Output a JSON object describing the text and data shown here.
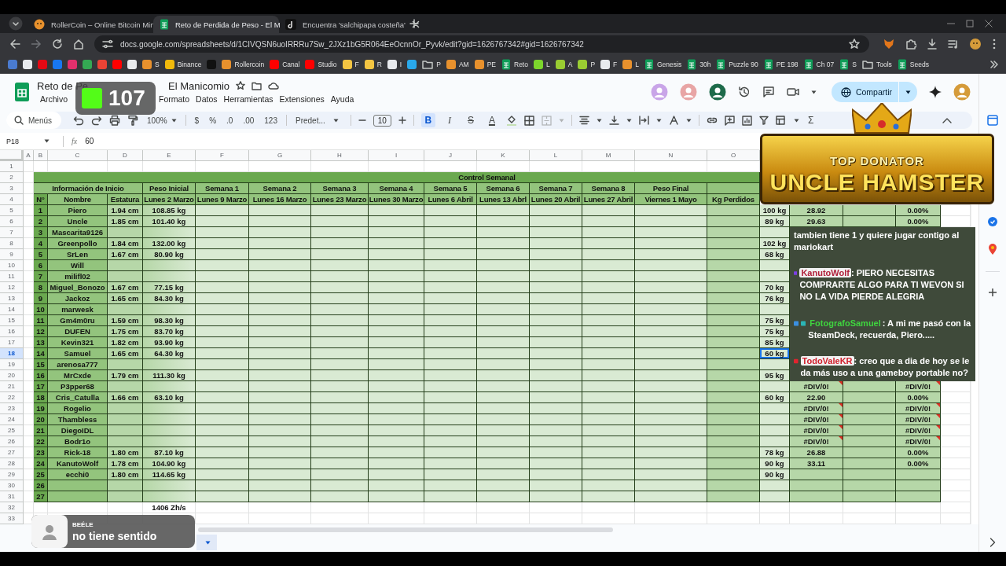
{
  "browser": {
    "tabs": [
      {
        "title": "RollerCoin – Online Bitcoin Min",
        "kind": "site",
        "selected": false
      },
      {
        "title": "Reto de Perdida de Peso - El M",
        "kind": "sheet",
        "selected": true
      },
      {
        "title": "Encuentra 'salchipapa costeña'",
        "kind": "music",
        "selected": false
      }
    ],
    "url": "docs.google.com/spreadsheets/d/1CIVQSN6uoIRRRu7Sw_2JXz1bG5R064EeOcnnOr_Pyvk/edit?gid=1626767342#gid=1626767342",
    "bookmarks": [
      {
        "kind": "site",
        "color": "#4a7bd0"
      },
      {
        "kind": "site",
        "color": "#e8eaed"
      },
      {
        "kind": "site",
        "color": "#e50914"
      },
      {
        "kind": "site",
        "color": "#1877f2"
      },
      {
        "kind": "site",
        "color": "#e1306c"
      },
      {
        "kind": "site",
        "color": "#34a853"
      },
      {
        "kind": "site",
        "color": "#ea4335"
      },
      {
        "kind": "site",
        "color": "#ff0000"
      },
      {
        "kind": "site",
        "color": "#e8eaed"
      },
      {
        "kind": "site",
        "color": "#e8912d",
        "label": "S"
      },
      {
        "kind": "site",
        "color": "#f0b90b",
        "label": "Binance"
      },
      {
        "kind": "site",
        "color": "#111111"
      },
      {
        "kind": "site",
        "color": "#e8912d",
        "label": "Rollercoin"
      },
      {
        "kind": "site",
        "color": "#ff0000",
        "label": "Canal"
      },
      {
        "kind": "site",
        "color": "#ff0000",
        "label": "Studio"
      },
      {
        "kind": "site",
        "color": "#f4c542",
        "label": "F"
      },
      {
        "kind": "site",
        "color": "#f4c542",
        "label": "R"
      },
      {
        "kind": "site",
        "color": "#e8eaed",
        "label": "I"
      },
      {
        "kind": "site",
        "color": "#29a9eb"
      },
      {
        "kind": "folder",
        "label": "P"
      },
      {
        "kind": "site",
        "color": "#e8912d",
        "label": "AM"
      },
      {
        "kind": "site",
        "color": "#e8912d",
        "label": "PE"
      },
      {
        "kind": "sheet",
        "label": "Reto"
      },
      {
        "kind": "site",
        "color": "#7cd52c",
        "label": "L"
      },
      {
        "kind": "site",
        "color": "#9acd32",
        "label": "A"
      },
      {
        "kind": "site",
        "color": "#9acd32",
        "label": "P"
      },
      {
        "kind": "site",
        "color": "#e8eaed",
        "label": "F"
      },
      {
        "kind": "site",
        "color": "#e8912d",
        "label": "L"
      },
      {
        "kind": "sheet",
        "label": "Genesis"
      },
      {
        "kind": "sheet",
        "label": "30h"
      },
      {
        "kind": "sheet",
        "label": "Puzzle 90"
      },
      {
        "kind": "sheet",
        "label": "PE 198"
      },
      {
        "kind": "sheet",
        "label": "Ch 07"
      },
      {
        "kind": "sheet",
        "label": "S"
      },
      {
        "kind": "folder",
        "label": "Tools"
      },
      {
        "kind": "sheet",
        "label": "Seeds"
      }
    ]
  },
  "document": {
    "title_parts": [
      "Reto de Pe",
      "El Manicomio"
    ],
    "menu": [
      "Archivo",
      "Formato",
      "Datos",
      "Herramientas",
      "Extensiones",
      "Ayuda"
    ],
    "share": "Compartir"
  },
  "toolbar": {
    "search": "Menús",
    "zoom": "100%",
    "number_formats": [
      "$",
      "%",
      ".0",
      ".00",
      "123"
    ],
    "font": "Predet...",
    "size": "10",
    "text_styles": [
      {
        "label": "B",
        "selected": true
      },
      {
        "label": "I",
        "selected": false
      },
      {
        "label": "S",
        "selected": false
      },
      {
        "label": "A",
        "selected": false
      }
    ],
    "functions": "Σ"
  },
  "formula_bar": {
    "cell": "P18",
    "fx": "fx",
    "formula": "60"
  },
  "columns": [
    "A",
    "B",
    "C",
    "D",
    "E",
    "F",
    "G",
    "H",
    "I",
    "J",
    "K",
    "L",
    "M",
    "N",
    "O"
  ],
  "row_headers": [
    {
      "label": "1",
      "selected": false
    },
    {
      "label": "2",
      "selected": false
    },
    {
      "label": "3",
      "selected": false
    },
    {
      "label": "4",
      "selected": false
    },
    {
      "label": "5",
      "selected": false
    },
    {
      "label": "6",
      "selected": false
    },
    {
      "label": "7",
      "selected": false
    },
    {
      "label": "8",
      "selected": false
    },
    {
      "label": "9",
      "selected": false
    },
    {
      "label": "10",
      "selected": false
    },
    {
      "label": "11",
      "selected": false
    },
    {
      "label": "12",
      "selected": false
    },
    {
      "label": "13",
      "selected": false
    },
    {
      "label": "14",
      "selected": false
    },
    {
      "label": "15",
      "selected": false
    },
    {
      "label": "16",
      "selected": false
    },
    {
      "label": "17",
      "selected": false
    },
    {
      "label": "18",
      "selected": true
    },
    {
      "label": "19",
      "selected": false
    },
    {
      "label": "20",
      "selected": false
    },
    {
      "label": "21",
      "selected": false
    },
    {
      "label": "22",
      "selected": false
    },
    {
      "label": "23",
      "selected": false
    },
    {
      "label": "24",
      "selected": false
    },
    {
      "label": "25",
      "selected": false
    },
    {
      "label": "26",
      "selected": false
    },
    {
      "label": "27",
      "selected": false
    },
    {
      "label": "28",
      "selected": false
    },
    {
      "label": "29",
      "selected": false
    },
    {
      "label": "30",
      "selected": false
    },
    {
      "label": "31",
      "selected": false
    },
    {
      "label": "32",
      "selected": false
    },
    {
      "label": "33",
      "selected": false
    }
  ],
  "sheet": {
    "section_title": "Control Semanal",
    "group_header": "Información de Inicio",
    "period_headers": [
      "Peso Inicial",
      "Semana 1",
      "Semana 2",
      "Semana 3",
      "Semana 4",
      "Semana 5",
      "Semana 6",
      "Semana 7",
      "Semana 8",
      "Peso Final"
    ],
    "column_headers": [
      "N°",
      "Nombre",
      "Estatura",
      "Lunes 2 Marzo",
      "Lunes 9 Marzo",
      "Lunes 16 Marzo",
      "Lunes 23 Marzo",
      "Lunes 30 Marzo",
      "Lunes 6 Abril",
      "Lunes 13 Abrl",
      "Lunes 20 Abril",
      "Lunes 27 Abril",
      "Viernes 1 Mayo",
      "Kg Perdidos"
    ],
    "participants": [
      {
        "n": "1",
        "name": "Piero",
        "height": "1.94 cm",
        "weight": "108.85 kg",
        "goal": "100 kg",
        "column_q": "28.92",
        "column_s": "0.00%",
        "error": false,
        "selected": false
      },
      {
        "n": "2",
        "name": "Uncle",
        "height": "1.85 cm",
        "weight": "101.40 kg",
        "goal": "89 kg",
        "column_q": "29.63",
        "column_s": "0.00%",
        "error": false,
        "selected": false
      },
      {
        "n": "3",
        "name": "Mascarita9126",
        "selected": false
      },
      {
        "n": "4",
        "name": "Greenpollo",
        "height": "1.84 cm",
        "weight": "132.00 kg",
        "goal": "102 kg",
        "selected": false
      },
      {
        "n": "5",
        "name": "SrLen",
        "height": "1.67 cm",
        "weight": "80.90 kg",
        "goal": "68 kg",
        "selected": false
      },
      {
        "n": "6",
        "name": "Will",
        "selected": false
      },
      {
        "n": "7",
        "name": "milifl02",
        "selected": false
      },
      {
        "n": "8",
        "name": "Miguel_Bonozo",
        "height": "1.67 cm",
        "weight": "77.15 kg",
        "goal": "70 kg",
        "selected": false
      },
      {
        "n": "9",
        "name": "Jackoz",
        "height": "1.65 cm",
        "weight": "84.30 kg",
        "goal": "76 kg",
        "selected": false
      },
      {
        "n": "10",
        "name": "marwesk",
        "selected": false
      },
      {
        "n": "11",
        "name": "Gm4m0ru",
        "height": "1.59 cm",
        "weight": "98.30 kg",
        "goal": "75 kg",
        "selected": false
      },
      {
        "n": "12",
        "name": "DUFEN",
        "height": "1.75 cm",
        "weight": "83.70 kg",
        "goal": "75 kg",
        "selected": false
      },
      {
        "n": "13",
        "name": "Kevin321",
        "height": "1.82 cm",
        "weight": "93.90 kg",
        "goal": "85 kg",
        "selected": false
      },
      {
        "n": "14",
        "name": "Samuel",
        "height": "1.65 cm",
        "weight": "64.30 kg",
        "goal": "60 kg",
        "selected": true
      },
      {
        "n": "15",
        "name": "arenosa777",
        "selected": false
      },
      {
        "n": "16",
        "name": "MrCxde",
        "height": "1.79 cm",
        "weight": "111.30 kg",
        "goal": "95 kg",
        "selected": false
      },
      {
        "n": "17",
        "name": "P3pper68",
        "column_q": "#DIV/0!",
        "column_s": "#DIV/0!",
        "error": true,
        "selected": false
      },
      {
        "n": "18",
        "name": "Cris_Catulla",
        "height": "1.66 cm",
        "weight": "63.10 kg",
        "goal": "60 kg",
        "column_q": "22.90",
        "column_s": "0.00%",
        "error": false,
        "selected": false
      },
      {
        "n": "19",
        "name": "Rogelio",
        "column_q": "#DIV/0!",
        "column_s": "#DIV/0!",
        "error": true,
        "selected": false
      },
      {
        "n": "20",
        "name": "Thambless",
        "column_q": "#DIV/0!",
        "column_s": "#DIV/0!",
        "error": true,
        "selected": false
      },
      {
        "n": "21",
        "name": "DiegoIDL",
        "column_q": "#DIV/0!",
        "column_s": "#DIV/0!",
        "error": true,
        "selected": false
      },
      {
        "n": "22",
        "name": "Bodr1o",
        "column_q": "#DIV/0!",
        "column_s": "#DIV/0!",
        "error": true,
        "selected": false
      },
      {
        "n": "23",
        "name": "Rick-18",
        "height": "1.80 cm",
        "weight": "87.10 kg",
        "goal": "78 kg",
        "column_q": "26.88",
        "column_s": "0.00%",
        "error": false,
        "selected": false
      },
      {
        "n": "24",
        "name": "KanutoWolf",
        "height": "1.78 cm",
        "weight": "104.90 kg",
        "goal": "90 kg",
        "column_q": "33.11",
        "column_s": "0.00%",
        "error": false,
        "selected": false
      },
      {
        "n": "25",
        "name": "ecchi0",
        "height": "1.80 cm",
        "weight": "114.65 kg",
        "goal": "90 kg",
        "error": false,
        "selected": false
      },
      {
        "n": "26",
        "error": false,
        "selected": false
      },
      {
        "n": "27",
        "error": false,
        "selected": false
      }
    ],
    "total": "1406 Zh/s"
  },
  "overlay": {
    "viewers": "107",
    "banner": {
      "line_1": "TOP DONATOR",
      "line_2": "UNCLE HAMSTER"
    },
    "chat": [
      {
        "text": "tambien tiene 1 y quiere jugar contigo al mariokart"
      },
      {
        "user": "KanutoWolf",
        "color": "#b0203a",
        "badges": [
          {
            "color": "#7b3fe4"
          }
        ],
        "text": ": PIERO NECESITAS COMPRARTE ALGO PARA TI WEVON SI NO LA VIDA PIERDE ALEGRIA"
      },
      {
        "user": "FotografoSamuel",
        "color": "#3fd43f",
        "badges": [
          {
            "color": "#3b8fe0"
          },
          {
            "color": "#2bb5b5"
          }
        ],
        "text": ": A mi me pasó con la SteamDeck, recuerda, Piero....."
      },
      {
        "user": "TodoValeKR",
        "color": "#d0202c",
        "badges": [
          {
            "color": "#e0242f"
          }
        ],
        "text": ": creo que a dia de hoy se le da más uso a una gameboy portable no?"
      }
    ],
    "alert": {
      "user": "BEÉLE",
      "text": "no tiene sentido"
    }
  }
}
